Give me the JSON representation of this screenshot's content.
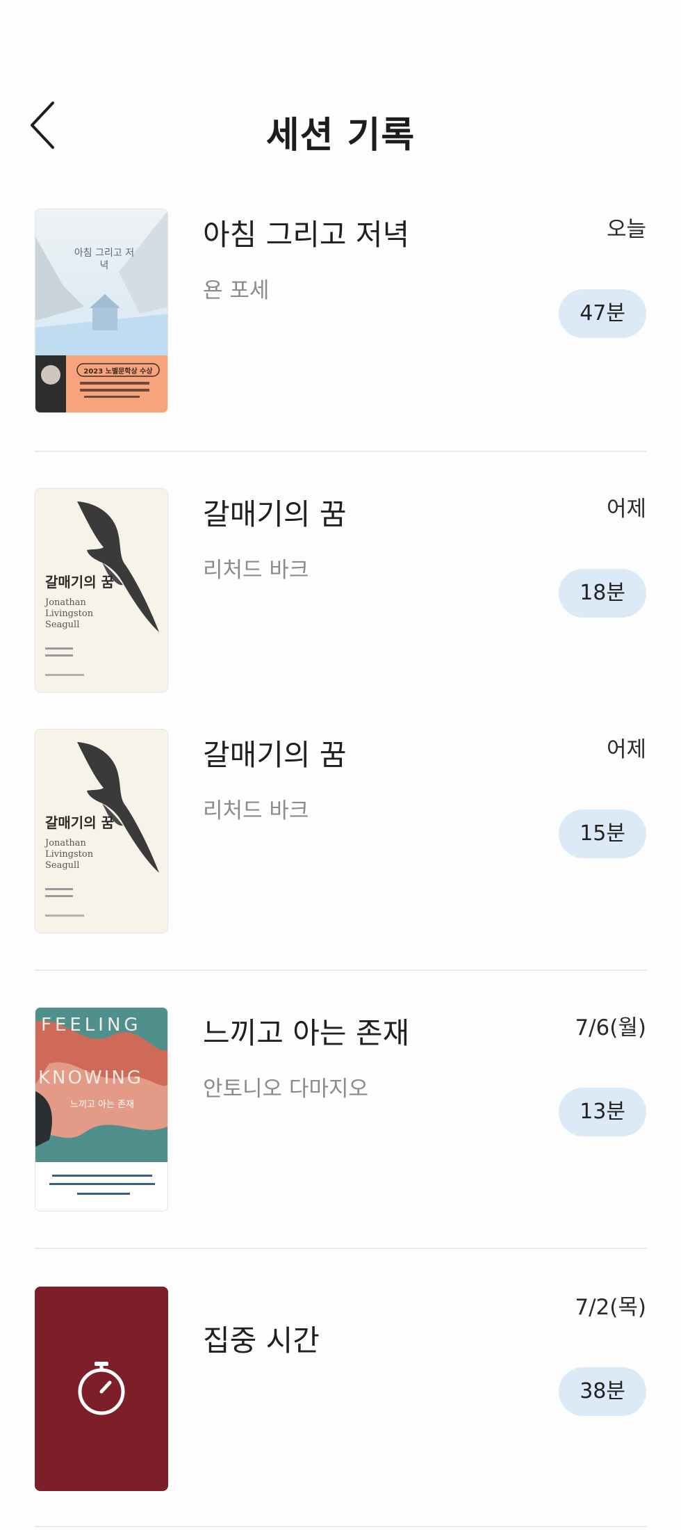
{
  "header": {
    "title": "세션 기록",
    "back_icon": "chevron-left-icon"
  },
  "sessions": [
    {
      "title": "아침 그리고 저녁",
      "author": "욘 포세",
      "date": "오늘",
      "duration": "47분",
      "cover": {
        "title_text": "아침 그리고 저녁",
        "badge": "2023 노벨문학상 수상"
      }
    },
    {
      "title": "갈매기의 꿈",
      "author": "리처드 바크",
      "date": "어제",
      "duration": "18분",
      "cover": {
        "title_text": "갈매기의 꿈",
        "subtitle": "Jonathan Livingston Seagull"
      }
    },
    {
      "title": "갈매기의 꿈",
      "author": "리처드 바크",
      "date": "어제",
      "duration": "15분",
      "cover": {
        "title_text": "갈매기의 꿈",
        "subtitle": "Jonathan Livingston Seagull"
      }
    },
    {
      "title": "느끼고 아는 존재",
      "author": "안토니오 다마지오",
      "date": "7/6(월)",
      "duration": "13분",
      "cover": {
        "title_en_1": "FEELING",
        "title_en_2": "KNOWING",
        "title_text": "느끼고 아는 존재"
      }
    },
    {
      "title": "집중 시간",
      "author": "",
      "date": "7/2(목)",
      "duration": "38분",
      "cover": {
        "icon": "stopwatch-icon",
        "color": "#7c1f28"
      }
    }
  ],
  "colors": {
    "duration_badge": "#dce9f6",
    "focus_tile": "#7c1f28"
  }
}
